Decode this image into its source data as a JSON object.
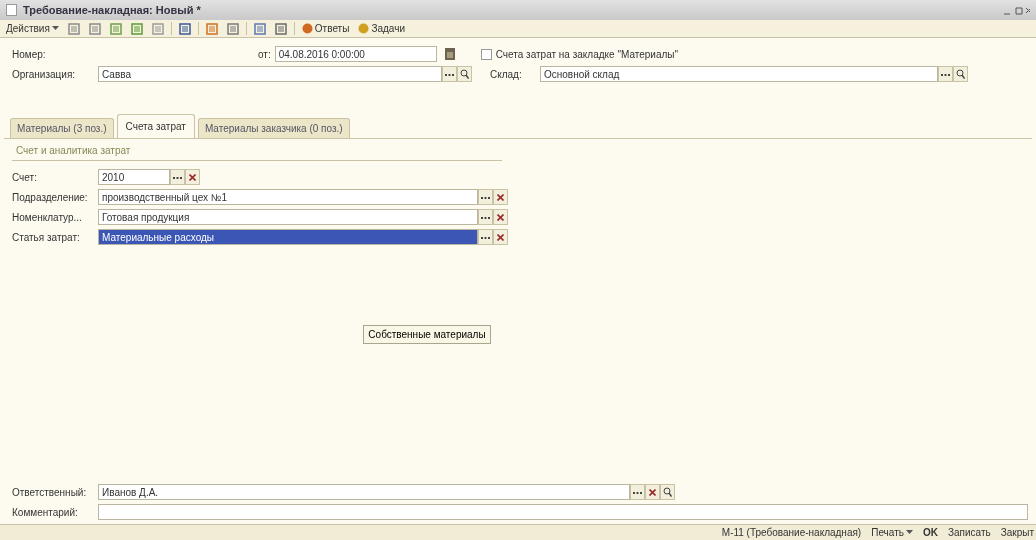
{
  "window": {
    "title": "Требование-накладная: Новый *"
  },
  "toolbar": {
    "actions_menu": "Действия",
    "buttons": [
      {
        "label": "Ответы"
      },
      {
        "label": "Задачи"
      }
    ]
  },
  "header": {
    "number_label": "Номер:",
    "date_label": "от:",
    "date": "04.08.2016 0:00:00",
    "cost_checkbox": {
      "label": "Счета затрат на закладке \"Материалы\"",
      "checked": false
    },
    "organization_label": "Организация:",
    "organization": "Савва",
    "warehouse_label": "Склад:",
    "warehouse": "Основной склад"
  },
  "tabs": [
    {
      "label": "Материалы (3 поз.)",
      "selected": false
    },
    {
      "label": "Счета затрат",
      "selected": true
    },
    {
      "label": "Материалы заказчика (0 поз.)",
      "selected": false
    }
  ],
  "group": {
    "title": "Счет и аналитика затрат",
    "rows": [
      {
        "label": "Счет:",
        "value": "2010",
        "kind": "short",
        "selected": false
      },
      {
        "label": "Подразделение:",
        "value": "производственный цех №1",
        "kind": "wide",
        "selected": false
      },
      {
        "label": "Номенклатур...",
        "value": "Готовая продукция",
        "kind": "wide",
        "selected": false
      },
      {
        "label": "Статья затрат:",
        "value": "Материальные расходы",
        "kind": "wide",
        "selected": true
      }
    ]
  },
  "materials_button": "Собственные материалы",
  "footer": {
    "responsible_label": "Ответственный:",
    "responsible": "Иванов Д.А.",
    "comment_label": "Комментарий:"
  },
  "status_bar": {
    "print_form": "М-11 (Требование-накладная)",
    "print": "Печать",
    "ok": "OK",
    "save": "Записать",
    "close": "Закрыт"
  }
}
